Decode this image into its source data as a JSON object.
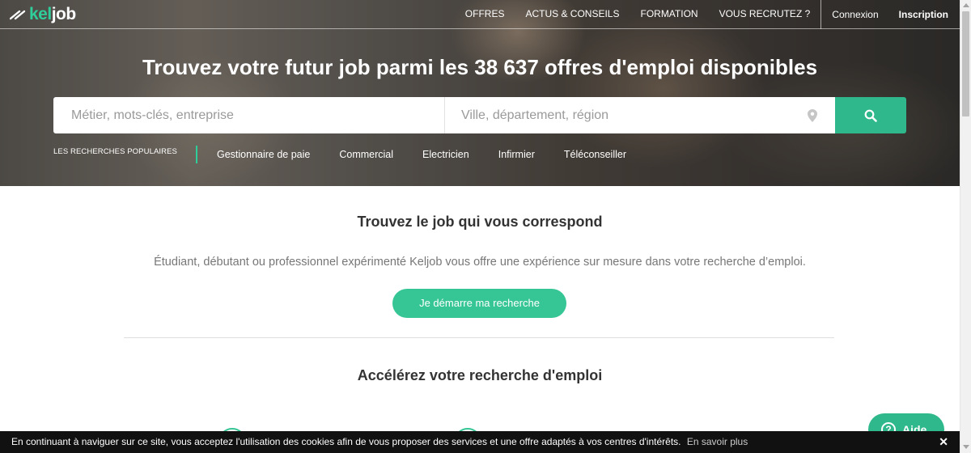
{
  "brand": {
    "name_part1": "kel",
    "name_part2": "job",
    "accent": "#2fcd9a",
    "button_green": "#36c595"
  },
  "nav": {
    "items": [
      "OFFRES",
      "ACTUS & CONSEILS",
      "FORMATION",
      "VOUS RECRUTEZ ?"
    ],
    "login": "Connexion",
    "signup": "Inscription"
  },
  "hero": {
    "title_before": "Trouvez votre futur job parmi les",
    "title_highlight": "38 637 offres d'emploi",
    "title_after": "disponibles"
  },
  "search": {
    "what_placeholder": "Métier, mots-clés, entreprise",
    "where_placeholder": "Ville, département, région",
    "button_icon": "search-icon",
    "location_icon": "map-pin-icon"
  },
  "popular": {
    "label": "LES RECHERCHES POPULAIRES",
    "links": [
      "Gestionnaire de paie",
      "Commercial",
      "Electricien",
      "Infirmier",
      "Téléconseiller"
    ]
  },
  "main": {
    "title": "Trouvez le job qui vous correspond",
    "description": "Étudiant, débutant ou professionnel expérimenté Keljob vous offre une expérience sur mesure dans votre recherche d’emploi.",
    "cta": "Je démarre ma recherche",
    "section_title": "Accélérez votre recherche d'emploi"
  },
  "help": {
    "label": "Aide",
    "icon": "help-icon"
  },
  "cookie": {
    "text": "En continuant à naviguer sur ce site, vous acceptez l'utilisation des cookies afin de vous proposer des services et une offre adaptés à vos centres d'intérêts.",
    "more": "En savoir plus",
    "close": "✕"
  }
}
